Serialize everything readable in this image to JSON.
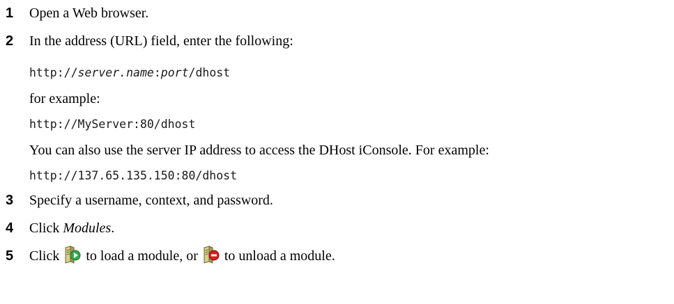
{
  "steps": [
    {
      "num": "1",
      "text": "Open a Web browser."
    },
    {
      "num": "2",
      "text": "In the address (URL) field, enter the following:"
    },
    {
      "num": "3",
      "text": "Specify a username, context, and password."
    },
    {
      "num": "4",
      "pre": "Click ",
      "link": "Modules",
      "post": "."
    },
    {
      "num": "5",
      "pre": "Click",
      "mid": "to load a module, or",
      "post": "to unload a module."
    }
  ],
  "url_template": {
    "prefix": "http://",
    "server": "server.name",
    "colon": ":",
    "port": "port",
    "suffix": "/dhost"
  },
  "for_example": "for example:",
  "example_url_1": "http://MyServer:80/dhost",
  "ip_note": "You can also use the server IP address to access the DHost iConsole. For example:",
  "example_url_2": "http://137.65.135.150:80/dhost",
  "icons": {
    "load": "load-module-icon",
    "unload": "unload-module-icon"
  },
  "colors": {
    "icon_body": "#c9c07a",
    "load_badge": "#34a84a",
    "unload_badge": "#d21f1f"
  }
}
